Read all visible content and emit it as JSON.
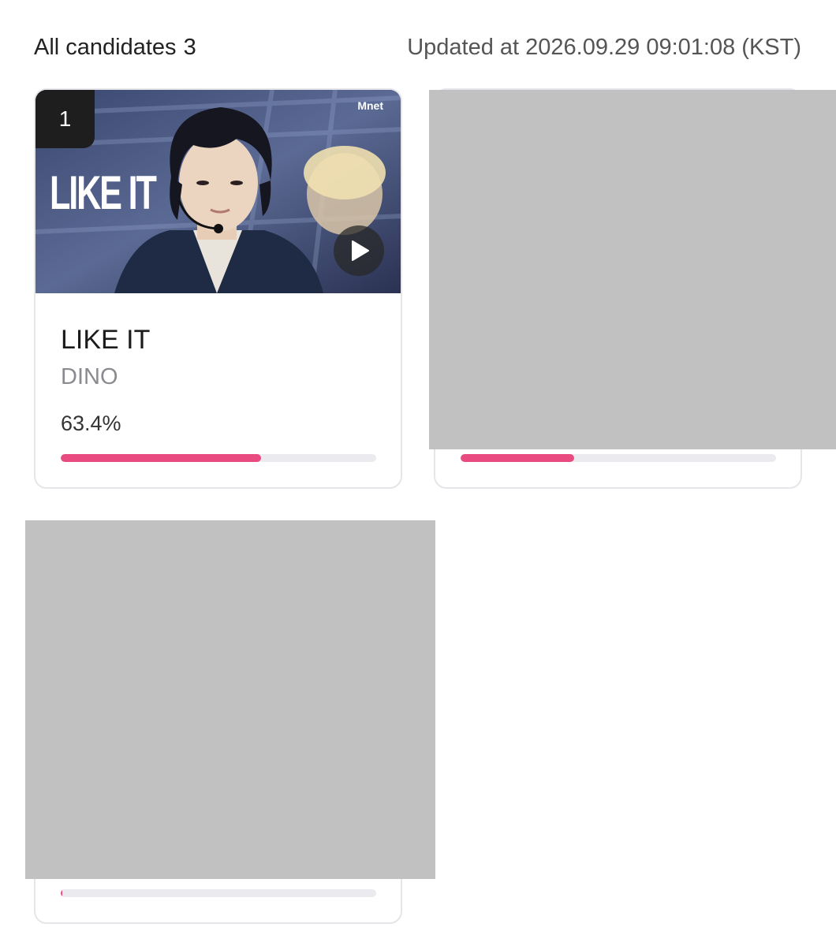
{
  "header": {
    "all_candidates_label": "All candidates",
    "candidate_count": "3",
    "updated_text": "Updated at 2026.09.29 09:01:08 (KST)"
  },
  "candidates": [
    {
      "rank": "1",
      "thumbnail_text": "LIKE IT",
      "brand_logo": "Mnet",
      "title": "LIKE IT",
      "artist": "DINO",
      "percent_label": "63.4%",
      "progress": 0.634
    },
    {
      "progress": 0.36
    },
    {
      "progress": 0.005
    }
  ],
  "colors": {
    "accent": "#e94a7f",
    "track": "#ebebef",
    "badge": "#1e1e1e",
    "redaction": "#c1c1c1"
  },
  "icons": {
    "play": "play-icon"
  }
}
